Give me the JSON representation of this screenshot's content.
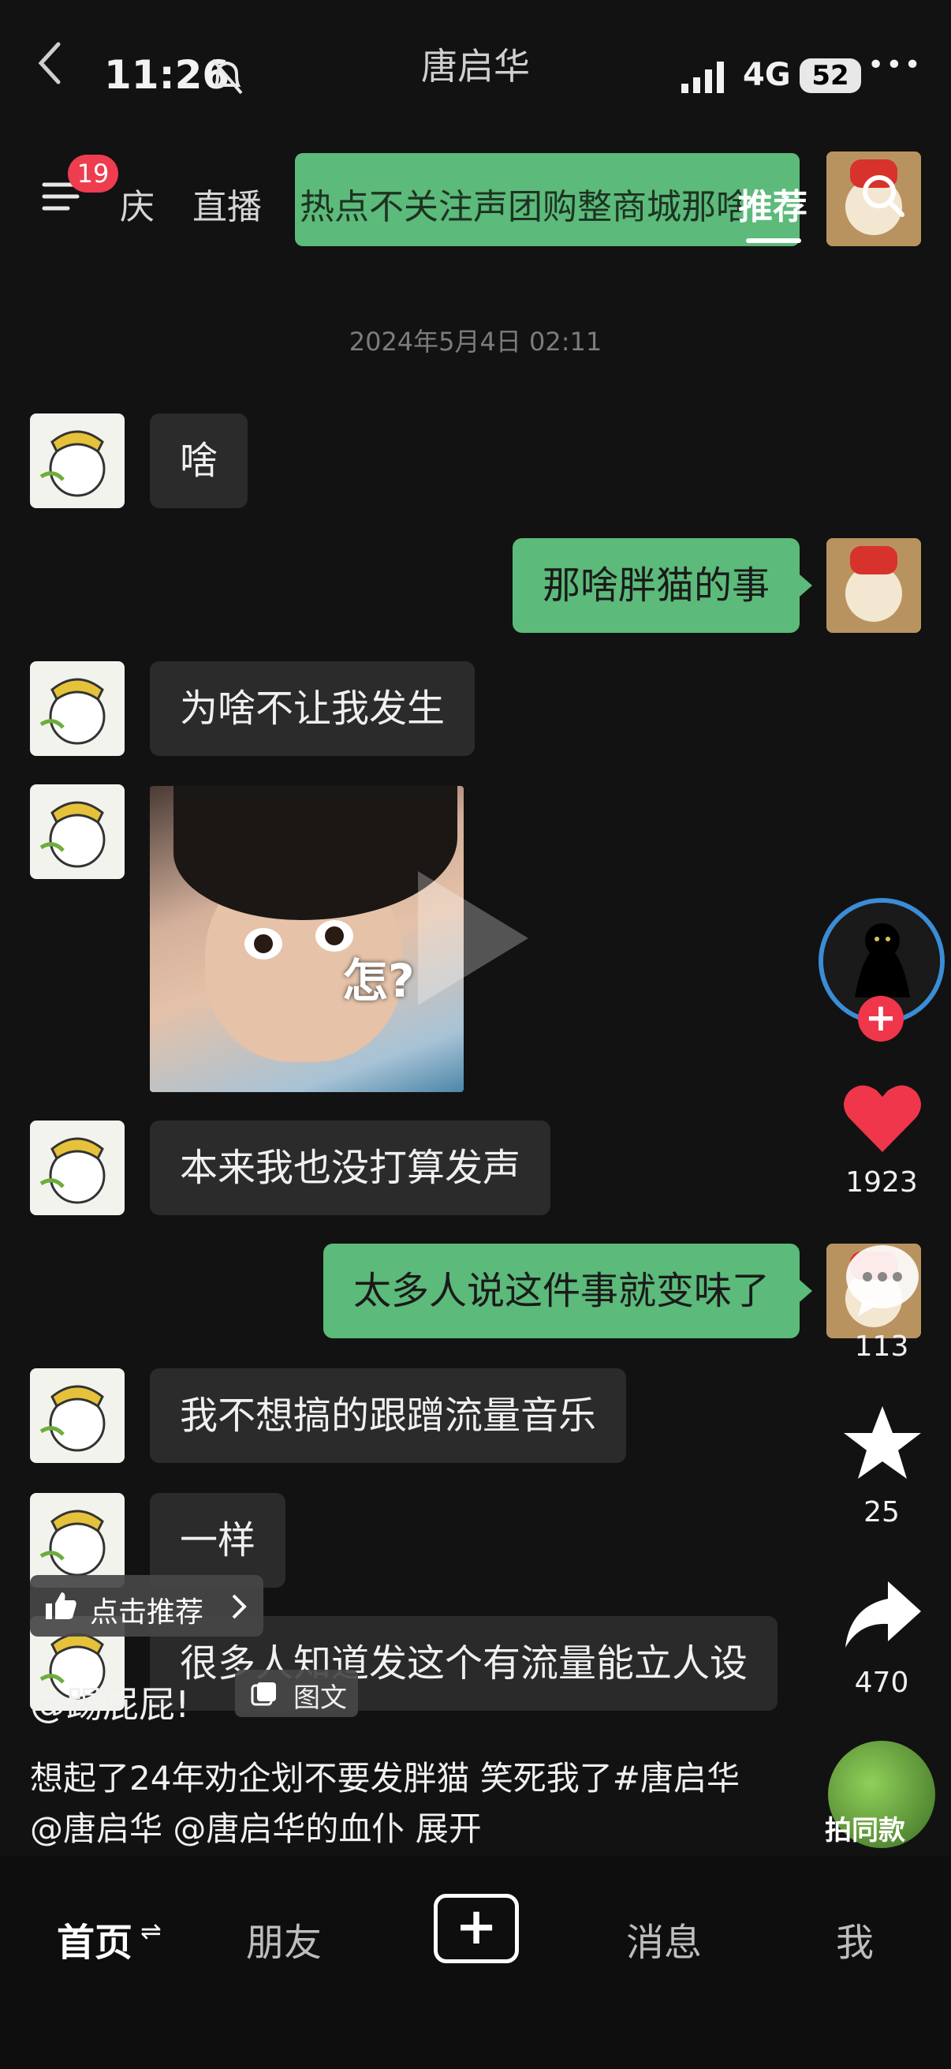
{
  "status_bar": {
    "time": "11:26",
    "network": "4G",
    "battery": "52"
  },
  "chat": {
    "title": "唐启华",
    "timestamp": "2024年5月4日 02:11"
  },
  "top_nav": {
    "badge_count": "19",
    "tabs": [
      "庆",
      "直播",
      "热点不关注声团购整商城"
    ],
    "overlay_text": "热点不关注声团购整商城那啥",
    "active_tab": "推荐"
  },
  "messages": [
    {
      "side": "left",
      "text": "啥"
    },
    {
      "side": "right",
      "text": "那啥胖猫的事"
    },
    {
      "side": "left",
      "text": "为啥不让我发生"
    },
    {
      "side": "left",
      "image_caption": "怎?"
    },
    {
      "side": "left",
      "text": "本来我也没打算发声"
    },
    {
      "side": "right",
      "text": "太多人说这件事就变味了"
    },
    {
      "side": "left",
      "text": "我不想搞的跟蹭流量音乐"
    },
    {
      "side": "left",
      "text": "一样"
    },
    {
      "side": "left",
      "text": "很多人知道发这个有流量能立人设"
    }
  ],
  "side_actions": {
    "likes": "1923",
    "comments": "113",
    "favorites": "25",
    "shares": "470",
    "music_label": "拍同款"
  },
  "post": {
    "recommend_chip": "点击推荐",
    "author": "@踢屁屁!",
    "type_chip": "图文",
    "description": "想起了24年劝企划不要发胖猫 笑死我了#唐启华 @唐启华 @唐启华的血仆 展开"
  },
  "bottom_nav": {
    "home": "首页",
    "friends": "朋友",
    "plus": "+",
    "messages": "消息",
    "me": "我"
  },
  "colors": {
    "accent_green": "#5cba7a",
    "badge_red": "#ee3d4f",
    "like_red": "#f0364a"
  }
}
